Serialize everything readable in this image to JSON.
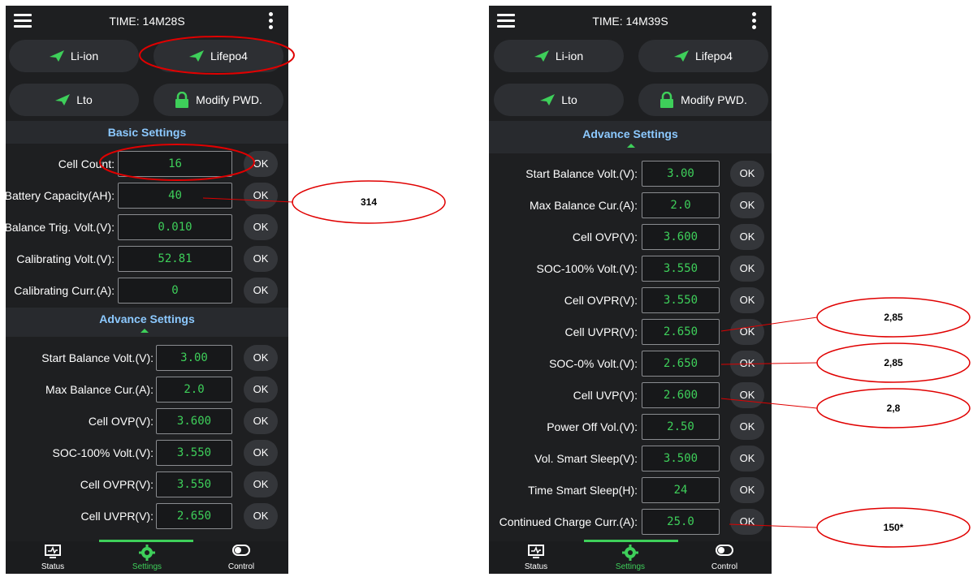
{
  "left": {
    "time_title": "TIME: 14M28S",
    "modes": [
      "Li-ion",
      "Lifepo4",
      "Lto",
      "Modify PWD."
    ],
    "basic_title": "Basic Settings",
    "basic_rows": [
      {
        "label": "Cell Count:",
        "value": "16",
        "ok": "OK"
      },
      {
        "label": "Battery Capacity(AH):",
        "value": "40",
        "ok": "OK"
      },
      {
        "label": "Balance Trig. Volt.(V):",
        "value": "0.010",
        "ok": "OK"
      },
      {
        "label": "Calibrating Volt.(V):",
        "value": "52.81",
        "ok": "OK"
      },
      {
        "label": "Calibrating Curr.(A):",
        "value": "0",
        "ok": "OK"
      }
    ],
    "advance_title": "Advance Settings",
    "advance_rows": [
      {
        "label": "Start Balance Volt.(V):",
        "value": "3.00",
        "ok": "OK"
      },
      {
        "label": "Max Balance Cur.(A):",
        "value": "2.0",
        "ok": "OK"
      },
      {
        "label": "Cell OVP(V):",
        "value": "3.600",
        "ok": "OK"
      },
      {
        "label": "SOC-100% Volt.(V):",
        "value": "3.550",
        "ok": "OK"
      },
      {
        "label": "Cell OVPR(V):",
        "value": "3.550",
        "ok": "OK"
      },
      {
        "label": "Cell UVPR(V):",
        "value": "2.650",
        "ok": "OK"
      }
    ],
    "nav": [
      "Status",
      "Settings",
      "Control"
    ]
  },
  "right": {
    "time_title": "TIME: 14M39S",
    "modes": [
      "Li-ion",
      "Lifepo4",
      "Lto",
      "Modify PWD."
    ],
    "advance_title": "Advance Settings",
    "advance_rows": [
      {
        "label": "Start Balance Volt.(V):",
        "value": "3.00",
        "ok": "OK"
      },
      {
        "label": "Max Balance Cur.(A):",
        "value": "2.0",
        "ok": "OK"
      },
      {
        "label": "Cell OVP(V):",
        "value": "3.600",
        "ok": "OK"
      },
      {
        "label": "SOC-100% Volt.(V):",
        "value": "3.550",
        "ok": "OK"
      },
      {
        "label": "Cell OVPR(V):",
        "value": "3.550",
        "ok": "OK"
      },
      {
        "label": "Cell UVPR(V):",
        "value": "2.650",
        "ok": "OK"
      },
      {
        "label": "SOC-0% Volt.(V):",
        "value": "2.650",
        "ok": "OK"
      },
      {
        "label": "Cell UVP(V):",
        "value": "2.600",
        "ok": "OK"
      },
      {
        "label": "Power Off Vol.(V):",
        "value": "2.50",
        "ok": "OK"
      },
      {
        "label": "Vol. Smart Sleep(V):",
        "value": "3.500",
        "ok": "OK"
      },
      {
        "label": "Time Smart Sleep(H):",
        "value": "24",
        "ok": "OK"
      },
      {
        "label": "Continued Charge Curr.(A):",
        "value": "25.0",
        "ok": "OK"
      }
    ],
    "nav": [
      "Status",
      "Settings",
      "Control"
    ]
  },
  "annotations": [
    "314",
    "2,85",
    "2,85",
    "2,8",
    "150*"
  ],
  "colors": {
    "accent_green": "#3ecf5a",
    "title_blue": "#8cc9ff",
    "annotation_red": "#e00000"
  }
}
